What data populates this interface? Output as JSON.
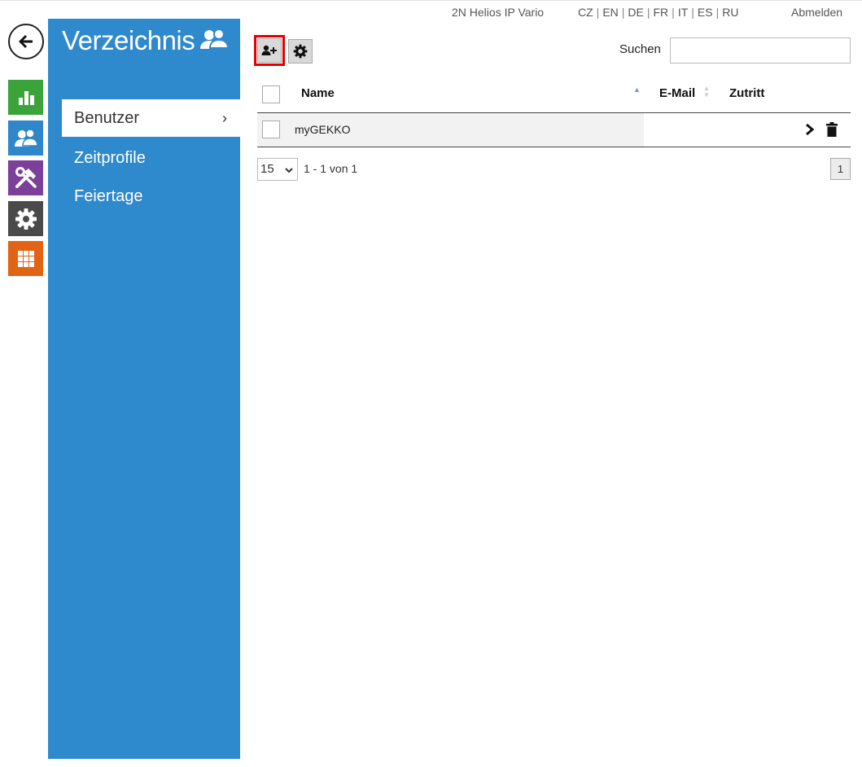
{
  "topbar": {
    "device_name": "2N Helios IP Vario",
    "languages": [
      "CZ",
      "EN",
      "DE",
      "FR",
      "IT",
      "ES",
      "RU"
    ],
    "logout_label": "Abmelden"
  },
  "rail": {
    "icons": [
      "back-arrow-icon",
      "status-chart-icon",
      "directory-users-icon",
      "hardware-tools-icon",
      "system-gear-icon",
      "services-grid-icon"
    ]
  },
  "sidebar": {
    "title": "Verzeichnis",
    "items": [
      {
        "label": "Benutzer",
        "active": true
      },
      {
        "label": "Zeitprofile",
        "active": false
      },
      {
        "label": "Feiertage",
        "active": false
      }
    ],
    "chevron": "›"
  },
  "toolbar": {
    "search_label": "Suchen",
    "search_value": ""
  },
  "table": {
    "columns": [
      "Name",
      "E-Mail",
      "Zutritt"
    ],
    "rows": [
      {
        "name": "myGEKKO",
        "email": "",
        "access": ""
      }
    ]
  },
  "pagination": {
    "page_size": "15",
    "info": "1 - 1 von 1",
    "current_page": "1"
  },
  "colors": {
    "sidebar": "#2f89cd",
    "status": "#3aa33a",
    "directory": "#2f86c9",
    "hardware": "#7c3f9a",
    "system": "#4a4a4a",
    "services": "#e16414",
    "highlight": "#e20000"
  }
}
